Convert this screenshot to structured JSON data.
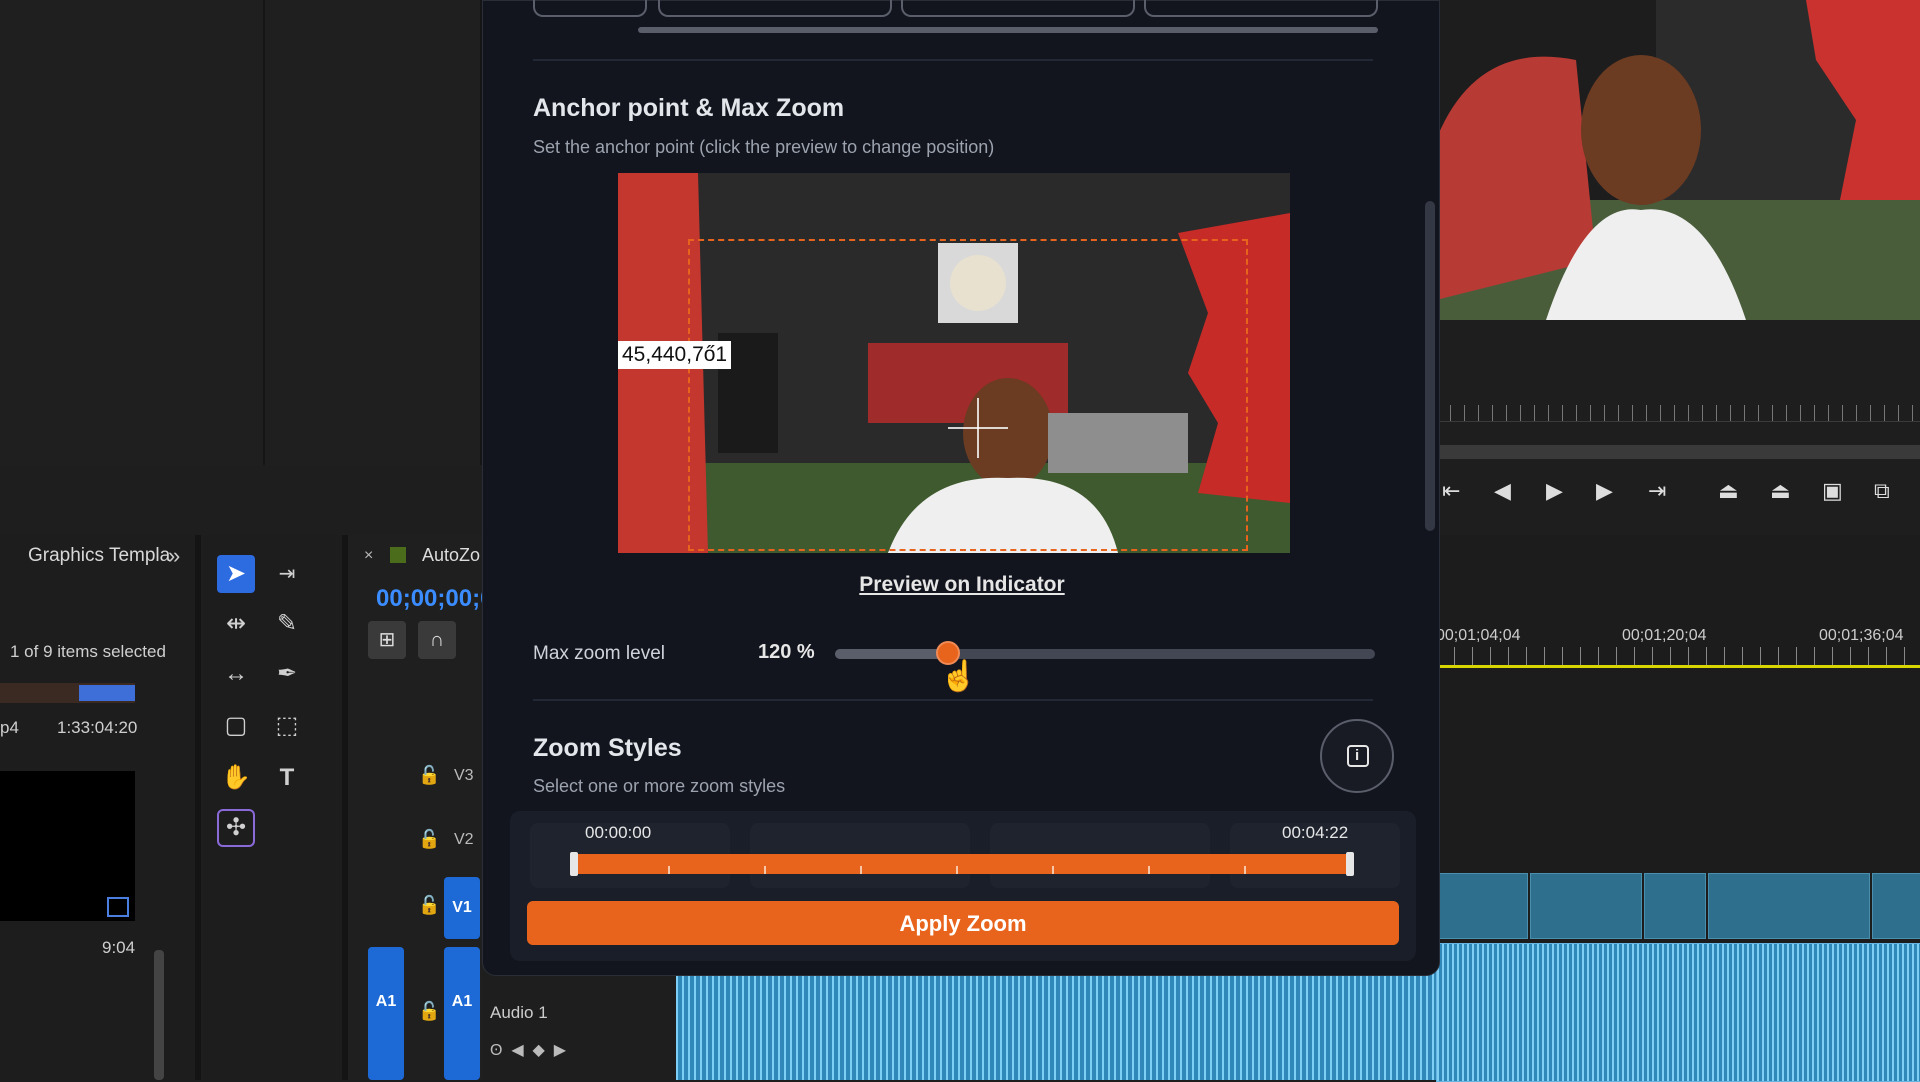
{
  "backdrop": {
    "project_panel": {
      "tab_label": "Graphics Templa",
      "expand_icon": "double-chevron-right-icon",
      "items_selected": "1 of 9 items selected",
      "file_name": "p4",
      "file_duration": "1:33:04:20",
      "clip_duration": "9:04"
    },
    "timeline": {
      "sequence_name": "AutoZo",
      "close_label": "×",
      "timecode": "00;00;00;0",
      "tracks": [
        {
          "label": "V3"
        },
        {
          "label": "V2"
        },
        {
          "label": "V1"
        },
        {
          "label": "A1"
        }
      ],
      "audio_track_name": "Audio 1",
      "source_patch": "A1",
      "ruler_times": [
        "00;01;04;04",
        "00;01;20;04",
        "00;01;36;04"
      ]
    }
  },
  "modal": {
    "anchor_section": {
      "title": "Anchor point & Max Zoom",
      "subtitle": "Set the anchor point (click the preview to change position)",
      "preview_counter": "45,440,7ő1",
      "preview_link": "Preview on Indicator"
    },
    "max_zoom": {
      "label": "Max zoom level",
      "value_text": "120 %",
      "slider_fraction": 0.21
    },
    "zoom_styles": {
      "title": "Zoom Styles",
      "subtitle": "Select one or more zoom styles",
      "info_icon": "info-icon",
      "time_start": "00:00:00",
      "time_end": "00:04:22",
      "apply_label": "Apply Zoom"
    }
  },
  "colors": {
    "accent": "#e8641c",
    "modal_bg": "#12151d",
    "premiere_blue": "#2d6be0"
  }
}
